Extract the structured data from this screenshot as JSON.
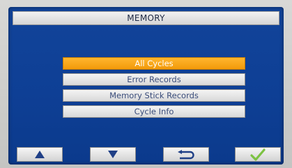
{
  "screen": {
    "title": "MEMORY"
  },
  "menu": {
    "items": [
      {
        "label": "All Cycles",
        "selected": true
      },
      {
        "label": "Error Records",
        "selected": false
      },
      {
        "label": "Memory Stick Records",
        "selected": false
      },
      {
        "label": "Cycle Info",
        "selected": false
      }
    ]
  },
  "softkeys": [
    {
      "icon": "up-arrow-icon"
    },
    {
      "icon": "down-arrow-icon"
    },
    {
      "icon": "return-arrow-icon"
    },
    {
      "icon": "checkmark-icon"
    }
  ],
  "colors": {
    "screen_background": "#0e3f95",
    "selected_item": "#f29a0a",
    "arrow_icons": "#1f3f86",
    "checkmark": "#7cc242"
  }
}
